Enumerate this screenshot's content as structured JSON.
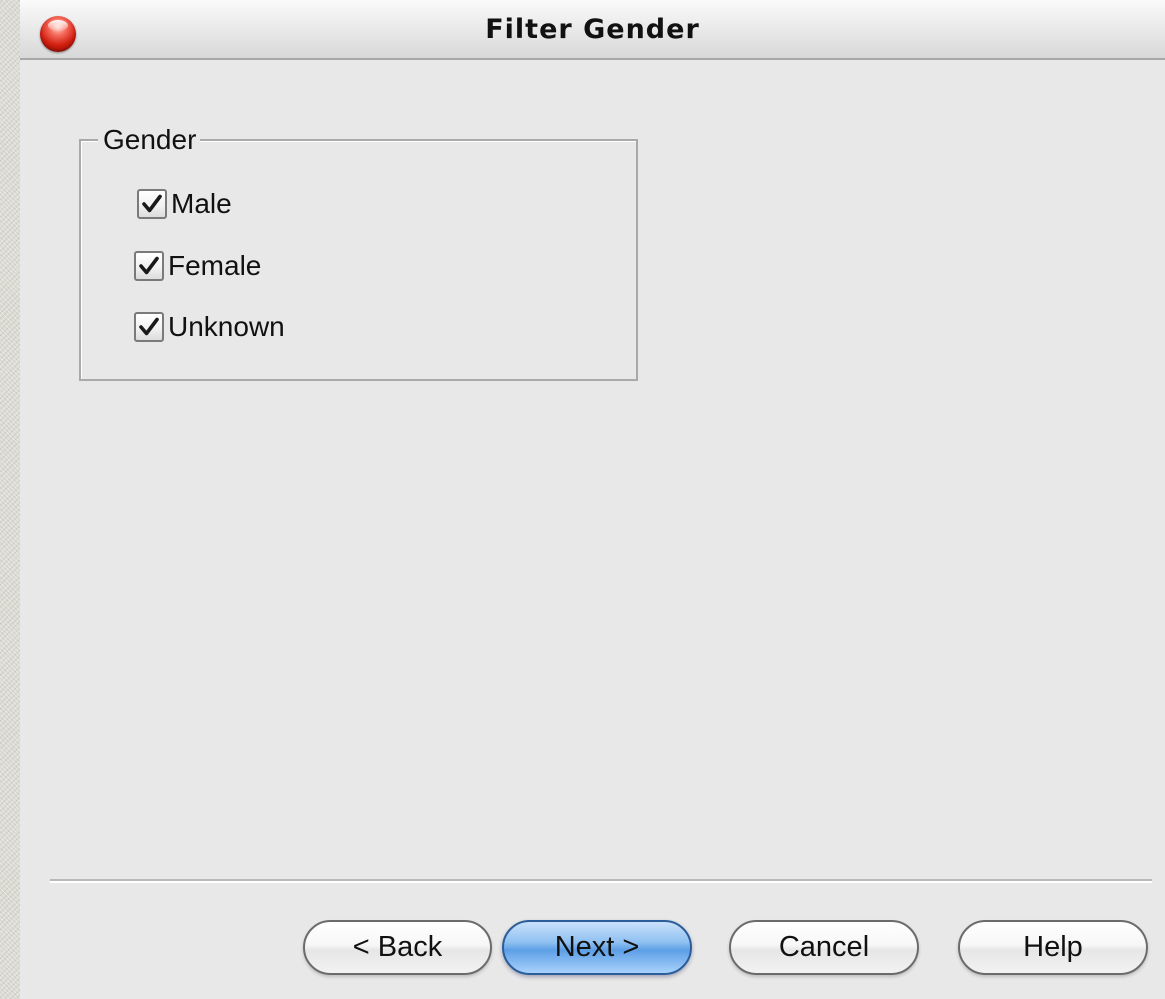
{
  "window": {
    "title": "Filter Gender",
    "close_icon": "close-icon"
  },
  "gender_group": {
    "legend": "Gender",
    "options": [
      {
        "label": "Male",
        "checked": true
      },
      {
        "label": "Female",
        "checked": true
      },
      {
        "label": "Unknown",
        "checked": true
      }
    ]
  },
  "buttons": {
    "back": "< Back",
    "next": "Next >",
    "cancel": "Cancel",
    "help": "Help"
  },
  "colors": {
    "primary_button": "#5d9fe6",
    "close_button": "#d11e10"
  }
}
